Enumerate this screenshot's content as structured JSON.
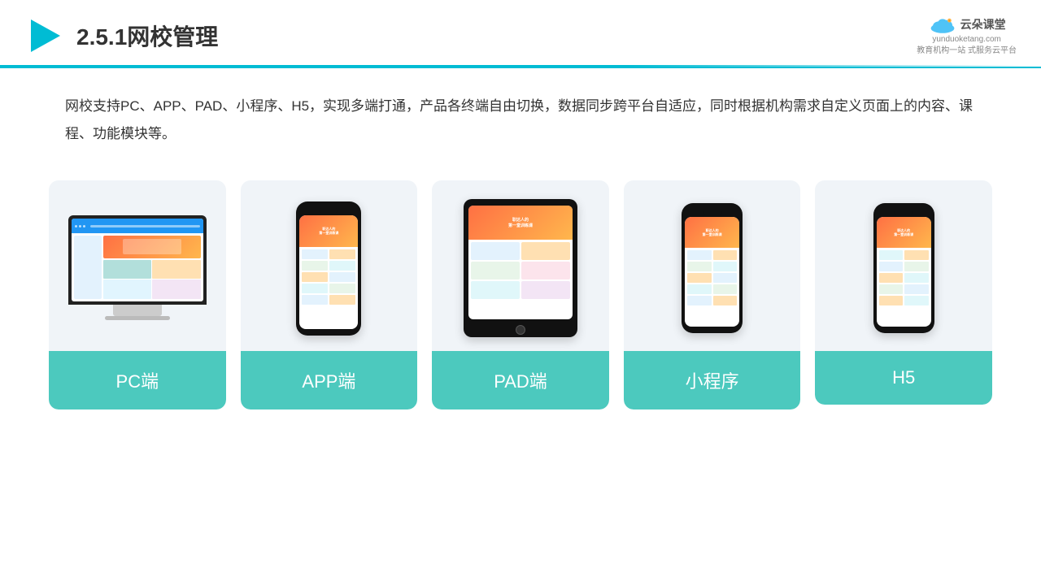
{
  "header": {
    "title": "2.5.1网校管理",
    "logo_name": "云朵课堂",
    "logo_url": "yunduoketang.com",
    "logo_subtitle": "教育机构一站\n式服务云平台"
  },
  "description": {
    "text": "网校支持PC、APP、PAD、小程序、H5，实现多端打通，产品各终端自由切换，数据同步跨平台自适应，同时根据机构需求自定义页面上的内容、课程、功能模块等。"
  },
  "cards": [
    {
      "id": "pc",
      "label": "PC端"
    },
    {
      "id": "app",
      "label": "APP端"
    },
    {
      "id": "pad",
      "label": "PAD端"
    },
    {
      "id": "miniprogram",
      "label": "小程序"
    },
    {
      "id": "h5",
      "label": "H5"
    }
  ]
}
